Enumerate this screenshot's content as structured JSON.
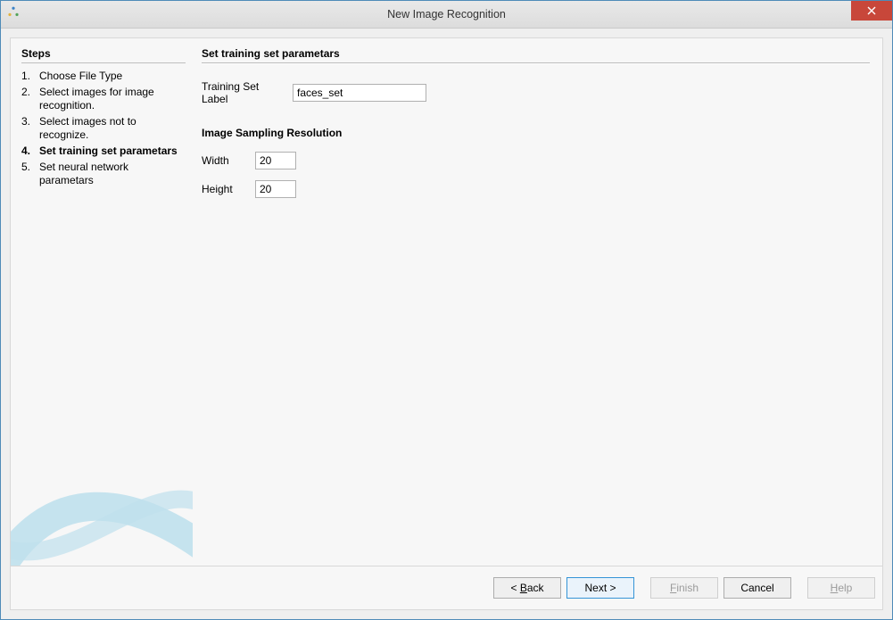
{
  "window": {
    "title": "New Image Recognition"
  },
  "steps": {
    "heading": "Steps",
    "items": [
      {
        "num": "1.",
        "label": "Choose File Type"
      },
      {
        "num": "2.",
        "label": "Select images for image recognition."
      },
      {
        "num": "3.",
        "label": "Select images not to recognize."
      },
      {
        "num": "4.",
        "label": "Set training set parametars"
      },
      {
        "num": "5.",
        "label": "Set neural network parametars"
      }
    ],
    "current_index": 3
  },
  "main": {
    "heading": "Set training set parametars",
    "training_label_caption": "Training Set Label",
    "training_label_value": "faces_set",
    "sampling_heading": "Image Sampling Resolution",
    "width_caption": "Width",
    "width_value": "20",
    "height_caption": "Height",
    "height_value": "20"
  },
  "footer": {
    "back": "ack",
    "back_prefix": "< ",
    "back_u": "B",
    "next": "Next >",
    "finish": "inish",
    "finish_u": "F",
    "cancel": "Cancel",
    "help": "elp",
    "help_u": "H"
  }
}
